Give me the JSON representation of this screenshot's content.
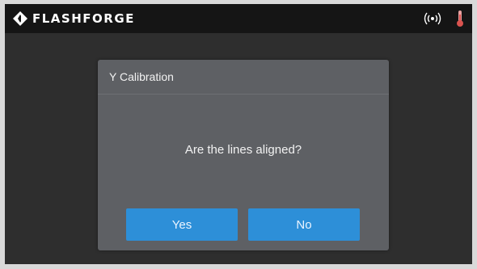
{
  "header": {
    "brand": "FLASHFORGE",
    "icons": {
      "logo": "flashforge-logo-icon",
      "status": "wifi-signal-icon",
      "temperature": "thermometer-icon"
    }
  },
  "dialog": {
    "title": "Y Calibration",
    "message": "Are the lines aligned?",
    "yes_label": "Yes",
    "no_label": "No"
  },
  "colors": {
    "accent": "#2d8fd8",
    "dialog_bg": "#5e6064",
    "screen_bg": "#2e2e2e",
    "topbar_bg": "#151515",
    "thermometer": "#d9534f"
  }
}
